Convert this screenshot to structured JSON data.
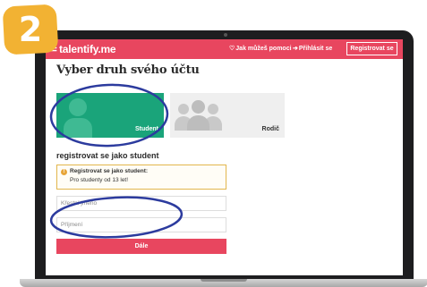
{
  "step": {
    "number": "2",
    "color": "#f2b233"
  },
  "navbar": {
    "brand": "talentify.me",
    "help_link": "Jak můžeš pomoci",
    "login_link": "Přihlásit se",
    "register_button": "Registrovat se",
    "color": "#e8465f",
    "help_icon": "heart-icon",
    "login_icon": "sign-in-icon"
  },
  "page": {
    "title": "Vyber druh svého účtu"
  },
  "account_types": [
    {
      "label": "Student",
      "selected": true,
      "color": "#1aa47a",
      "icon": "person-icon"
    },
    {
      "label": "Rodič",
      "selected": false,
      "color": "#efefef",
      "icon": "group-icon"
    }
  ],
  "registration": {
    "section_title": "registrovat se jako student",
    "notice_title": "Registrovat se jako student:",
    "notice_text": "Pro studenty od 13 let!",
    "notice_icon": "alert-icon",
    "first_name_placeholder": "Křestní jméno",
    "last_name_placeholder": "Příjmení",
    "submit_label": "Dále"
  },
  "annotation": {
    "ellipse_color": "#2c3b9e"
  }
}
